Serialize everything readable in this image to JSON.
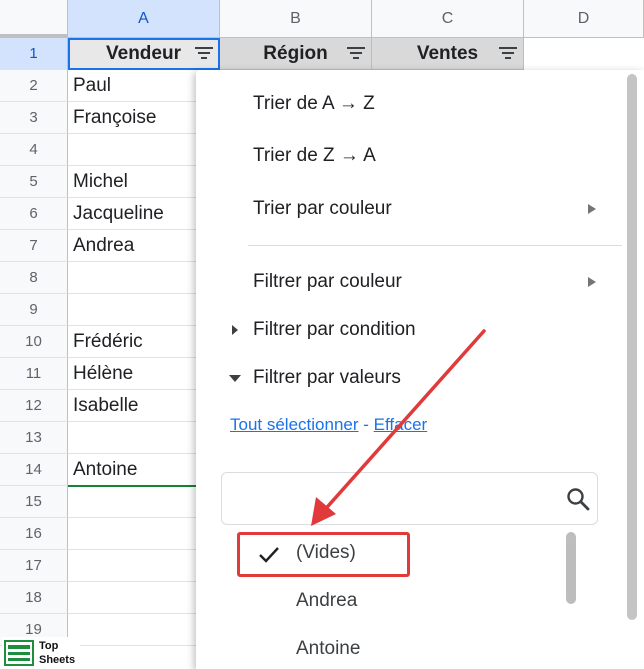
{
  "sheet": {
    "columns": [
      "A",
      "B",
      "C",
      "D"
    ],
    "rows": [
      "1",
      "2",
      "3",
      "4",
      "5",
      "6",
      "7",
      "8",
      "9",
      "10",
      "11",
      "12",
      "13",
      "14",
      "15",
      "16",
      "17",
      "18",
      "19"
    ],
    "header_row": [
      "Vendeur",
      "Région",
      "Ventes"
    ],
    "column_a": [
      "Paul",
      "Françoise",
      "",
      "Michel",
      "Jacqueline",
      "Andrea",
      "",
      "",
      "Frédéric",
      "Hélène",
      "Isabelle",
      "",
      "Antoine"
    ]
  },
  "menu": {
    "sort_az": "Trier de A → Z",
    "sort_za": "Trier de Z → A",
    "sort_by_color": "Trier par couleur",
    "filter_by_color": "Filtrer par couleur",
    "filter_by_condition": "Filtrer par condition",
    "filter_by_values": "Filtrer par valeurs",
    "select_all": "Tout sélectionner",
    "separator": " - ",
    "clear": "Effacer",
    "search_placeholder": "",
    "values": [
      "(Vides)",
      "Andrea",
      "Antoine"
    ]
  },
  "logo": {
    "line1": "Top",
    "line2": "Sheets"
  },
  "colors": {
    "selection": "#1a73e8",
    "highlight": "#e03a3a",
    "annotation_arrow": "#e03a3a"
  }
}
